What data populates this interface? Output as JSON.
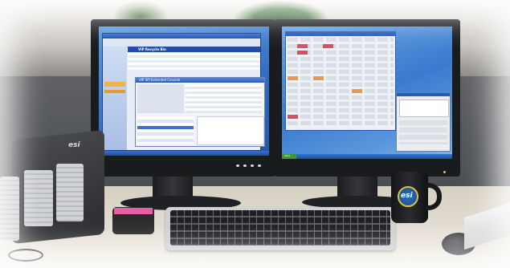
{
  "scene": {
    "phone_brand": "esi",
    "mug_brand": "esi",
    "left_window_title": "VIP Recycle Bin",
    "left_subwindow_title": "VIP SPI Extended Console",
    "start_button_label": "start"
  }
}
